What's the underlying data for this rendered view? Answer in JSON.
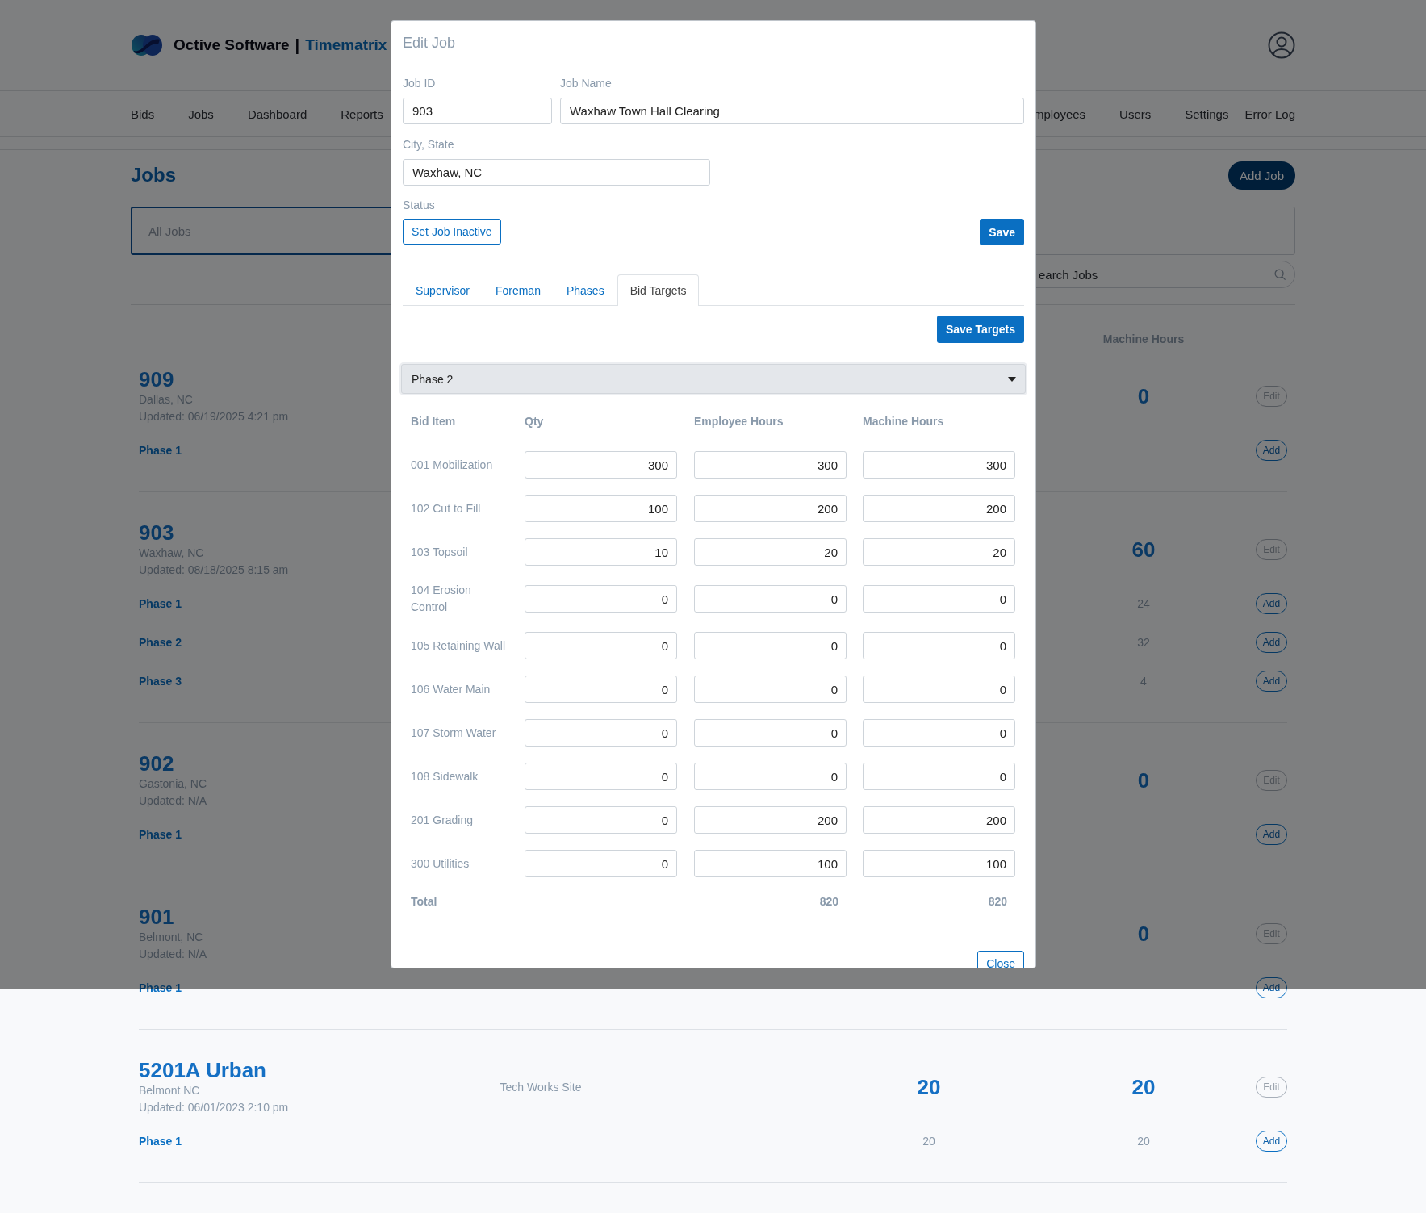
{
  "header": {
    "brand": "Octive Software",
    "separator": "|",
    "product": "Timematrix"
  },
  "nav": {
    "left": [
      "Bids",
      "Jobs",
      "Dashboard",
      "Reports"
    ],
    "right": [
      "mployees",
      "Users",
      "Settings",
      "Error Log"
    ]
  },
  "page": {
    "title": "Jobs",
    "add_button": "Add Job"
  },
  "filters": [
    {
      "label": "All Jobs",
      "selected": true
    },
    {
      "selected": false
    }
  ],
  "search": {
    "placeholder": "earch Jobs"
  },
  "columns": {
    "machine_hours": "Machine Hours"
  },
  "jobs": [
    {
      "number": "909",
      "city": "Dallas, NC",
      "updated": "Updated: 06/19/2025 4:21 pm",
      "machine_hours": "0",
      "edit": "Edit",
      "phases": [
        {
          "name": "Phase 1",
          "add": "Add"
        }
      ]
    },
    {
      "number": "903",
      "city": "Waxhaw, NC",
      "updated": "Updated: 08/18/2025 8:15 am",
      "machine_hours": "60",
      "edit": "Edit",
      "phases": [
        {
          "name": "Phase 1",
          "machine_hours": "24",
          "add": "Add"
        },
        {
          "name": "Phase 2",
          "machine_hours": "32",
          "add": "Add"
        },
        {
          "name": "Phase 3",
          "machine_hours": "4",
          "add": "Add"
        }
      ]
    },
    {
      "number": "902",
      "city": "Gastonia, NC",
      "updated": "Updated: N/A",
      "machine_hours": "0",
      "edit": "Edit",
      "phases": [
        {
          "name": "Phase 1",
          "add": "Add"
        }
      ]
    },
    {
      "number": "901",
      "city": "Belmont, NC",
      "updated": "Updated: N/A",
      "machine_hours": "0",
      "edit": "Edit",
      "phases": [
        {
          "name": "Phase 1",
          "add": "Add"
        }
      ]
    },
    {
      "number": "5201A Urban",
      "city": "Belmont NC",
      "updated": "Updated: 06/01/2023 2:10 pm",
      "site": "Tech Works Site",
      "employee_hours": "20",
      "machine_hours": "20",
      "edit": "Edit",
      "phases": [
        {
          "name": "Phase 1",
          "employee_hours": "20",
          "machine_hours": "20",
          "add": "Add"
        }
      ]
    }
  ],
  "modal": {
    "title": "Edit Job",
    "fields": [
      {
        "label": "Job ID",
        "value": "903"
      },
      {
        "label": "Job Name",
        "value": "Waxhaw Town Hall Clearing"
      },
      {
        "label": "City, State",
        "value": "Waxhaw, NC"
      }
    ],
    "status_label": "Status",
    "status_button": "Set Job Inactive",
    "save_button": "Save",
    "tabs": [
      {
        "label": "Supervisor",
        "selected": false
      },
      {
        "label": "Foreman",
        "selected": false
      },
      {
        "label": "Phases",
        "selected": false
      },
      {
        "label": "Bid Targets",
        "selected": true
      }
    ],
    "save_targets_button": "Save Targets",
    "phase_select": "Phase 2",
    "table": {
      "columns": [
        "Bid Item",
        "Qty",
        "Employee Hours",
        "Machine Hours"
      ],
      "rows": [
        {
          "item": "001 Mobilization",
          "qty": "300",
          "employee_hours": "300",
          "machine_hours": "300"
        },
        {
          "item": "102 Cut to Fill",
          "qty": "100",
          "employee_hours": "200",
          "machine_hours": "200"
        },
        {
          "item": "103 Topsoil",
          "qty": "10",
          "employee_hours": "20",
          "machine_hours": "20"
        },
        {
          "item": "104 Erosion Control",
          "qty": "0",
          "employee_hours": "0",
          "machine_hours": "0"
        },
        {
          "item": "105 Retaining Wall",
          "qty": "0",
          "employee_hours": "0",
          "machine_hours": "0"
        },
        {
          "item": "106 Water Main",
          "qty": "0",
          "employee_hours": "0",
          "machine_hours": "0"
        },
        {
          "item": "107 Storm Water",
          "qty": "0",
          "employee_hours": "0",
          "machine_hours": "0"
        },
        {
          "item": "108 Sidewalk",
          "qty": "0",
          "employee_hours": "0",
          "machine_hours": "0"
        },
        {
          "item": "201 Grading",
          "qty": "0",
          "employee_hours": "200",
          "machine_hours": "200"
        },
        {
          "item": "300 Utilities",
          "qty": "0",
          "employee_hours": "100",
          "machine_hours": "100"
        }
      ],
      "total": {
        "label": "Total",
        "employee_hours": "820",
        "machine_hours": "820"
      }
    },
    "close_button": "Close"
  }
}
